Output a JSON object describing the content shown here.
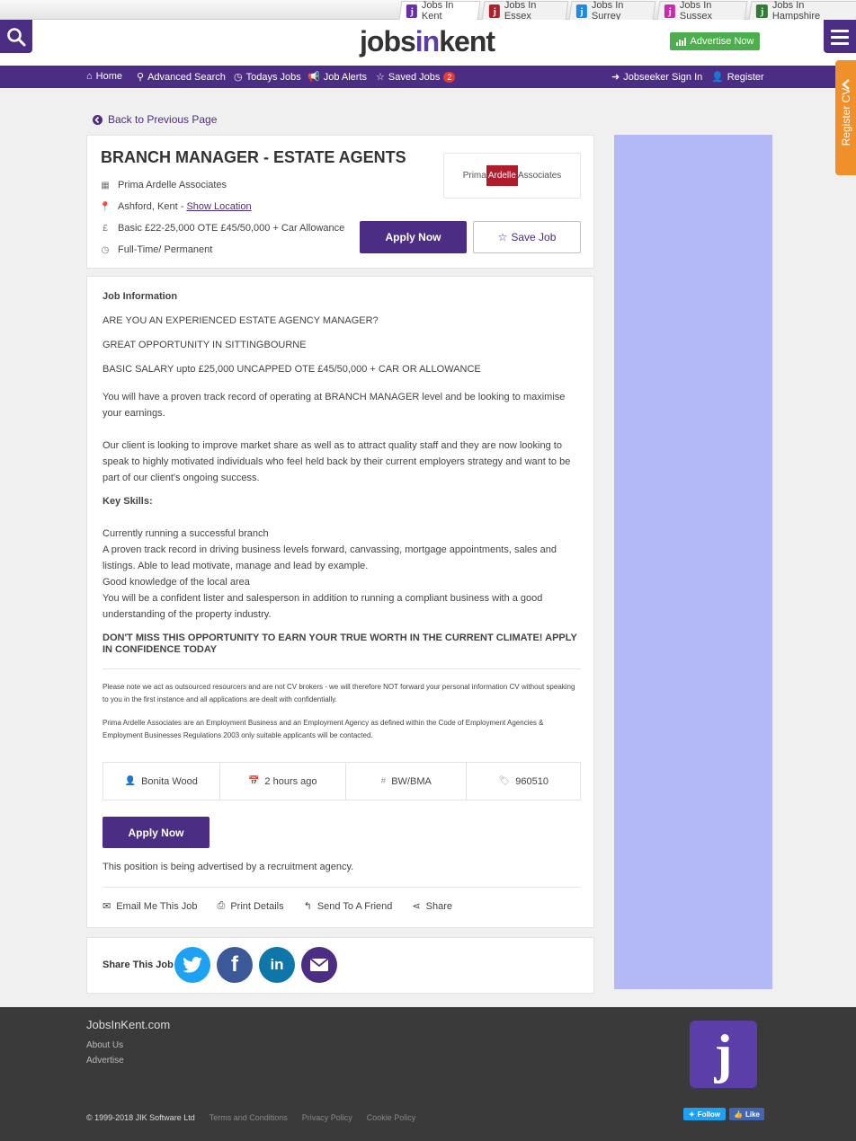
{
  "site_tabs": [
    {
      "label": "Jobs In Kent",
      "color": "#6a2fa8"
    },
    {
      "label": "Jobs In Essex",
      "color": "#b0202a"
    },
    {
      "label": "Jobs In Surrey",
      "color": "#1e88e5"
    },
    {
      "label": "Jobs In Sussex",
      "color": "#c82ab0"
    },
    {
      "label": "Jobs In Hampshire",
      "color": "#2e7d32"
    }
  ],
  "header": {
    "brand_a": "jobs",
    "brand_b": "in",
    "brand_c": "kent",
    "advertise": "Advertise Now"
  },
  "nav": {
    "home": "Home",
    "advanced": "Advanced Search",
    "todays": "Todays Jobs",
    "alerts": "Job Alerts",
    "saved": "Saved Jobs",
    "saved_count": "2",
    "signin": "Jobseeker Sign In",
    "register": "Register"
  },
  "register_cv": "Register CV",
  "back": "Back to Previous Page",
  "job": {
    "title": "BRANCH MANAGER - ESTATE AGENTS",
    "company": "Prima Ardelle Associates",
    "location": "Ashford, Kent - ",
    "show_location": "Show Location",
    "salary": "Basic £22-25,000 OTE £45/50,000 + Car Allowance",
    "type": "Full-Time/ Permanent",
    "logo": {
      "a": "Prima",
      "b": "Ardelle",
      "c": "Associates"
    },
    "apply": "Apply Now",
    "save": "Save Job"
  },
  "info": {
    "heading": "Job Information",
    "l1": "ARE YOU AN EXPERIENCED ESTATE AGENCY MANAGER?",
    "l2": "GREAT OPPORTUNITY IN SITTINGBOURNE",
    "l3": "BASIC SALARY upto £25,000 UNCAPPED OTE £45/50,000 + CAR OR ALLOWANCE",
    "p1": "You will have a proven track record of operating at BRANCH MANAGER level and be looking to maximise your earnings.",
    "p2": "Our client is looking to improve market share as well as to attract quality staff and they are now looking to speak to highly motivated individuals who feel held back by their current employers strategy and want to be part of our client's ongoing success.",
    "skills_heading": "Key Skills:",
    "s1": "Currently running a successful branch",
    "s2": "A proven track record in driving business levels forward, canvassing, mortgage appointments, sales and listings. Able to lead motivate, manage and lead by example.",
    "s3": "Good knowledge of the local area",
    "s4": "You will be a confident lister and salesperson in addition to running a compliant business with a good understanding of the property industry.",
    "cta": "DON'T MISS THIS OPPORTUNITY TO EARN YOUR TRUE WORTH IN THE CURRENT CLIMATE! APPLY IN CONFIDENCE TODAY",
    "note1": "Please note we act as outsourced resourcers and are not CV brokers - we will therefore NOT forward your personal information CV without speaking to you in the first instance and all applications are dealt with confidentially.",
    "note2": "Prima Ardelle Associates are an Employment Business and an Employment Agency as defined within the Code of Employment Agencies & Employment Businesses Regulations 2003 only suitable applicants will be contacted."
  },
  "stats": {
    "contact": "Bonita Wood",
    "posted": "2 hours ago",
    "ref": "BW/BMA",
    "id": "960510"
  },
  "apply2": "Apply Now",
  "agency_note": "This position is being advertised by a recruitment agency.",
  "actions": {
    "email": "Email Me This Job",
    "print": "Print Details",
    "friend": "Send To A Friend",
    "share": "Share"
  },
  "share": {
    "title": "Share This Job",
    "twitter_color": "#1da1f2",
    "facebook_color": "#3b5998",
    "linkedin_color": "#0e76a8",
    "email_color": "#4b2e83"
  },
  "footer": {
    "site": "JobsInKent.com",
    "about": "About Us",
    "advertise": "Advertise",
    "copyright": "© 1999-2018 JIK Software Ltd",
    "terms": "Terms and Conditions",
    "privacy": "Privacy Policy",
    "cookie": "Cookie Policy",
    "follow": "Follow",
    "like": "Like"
  }
}
